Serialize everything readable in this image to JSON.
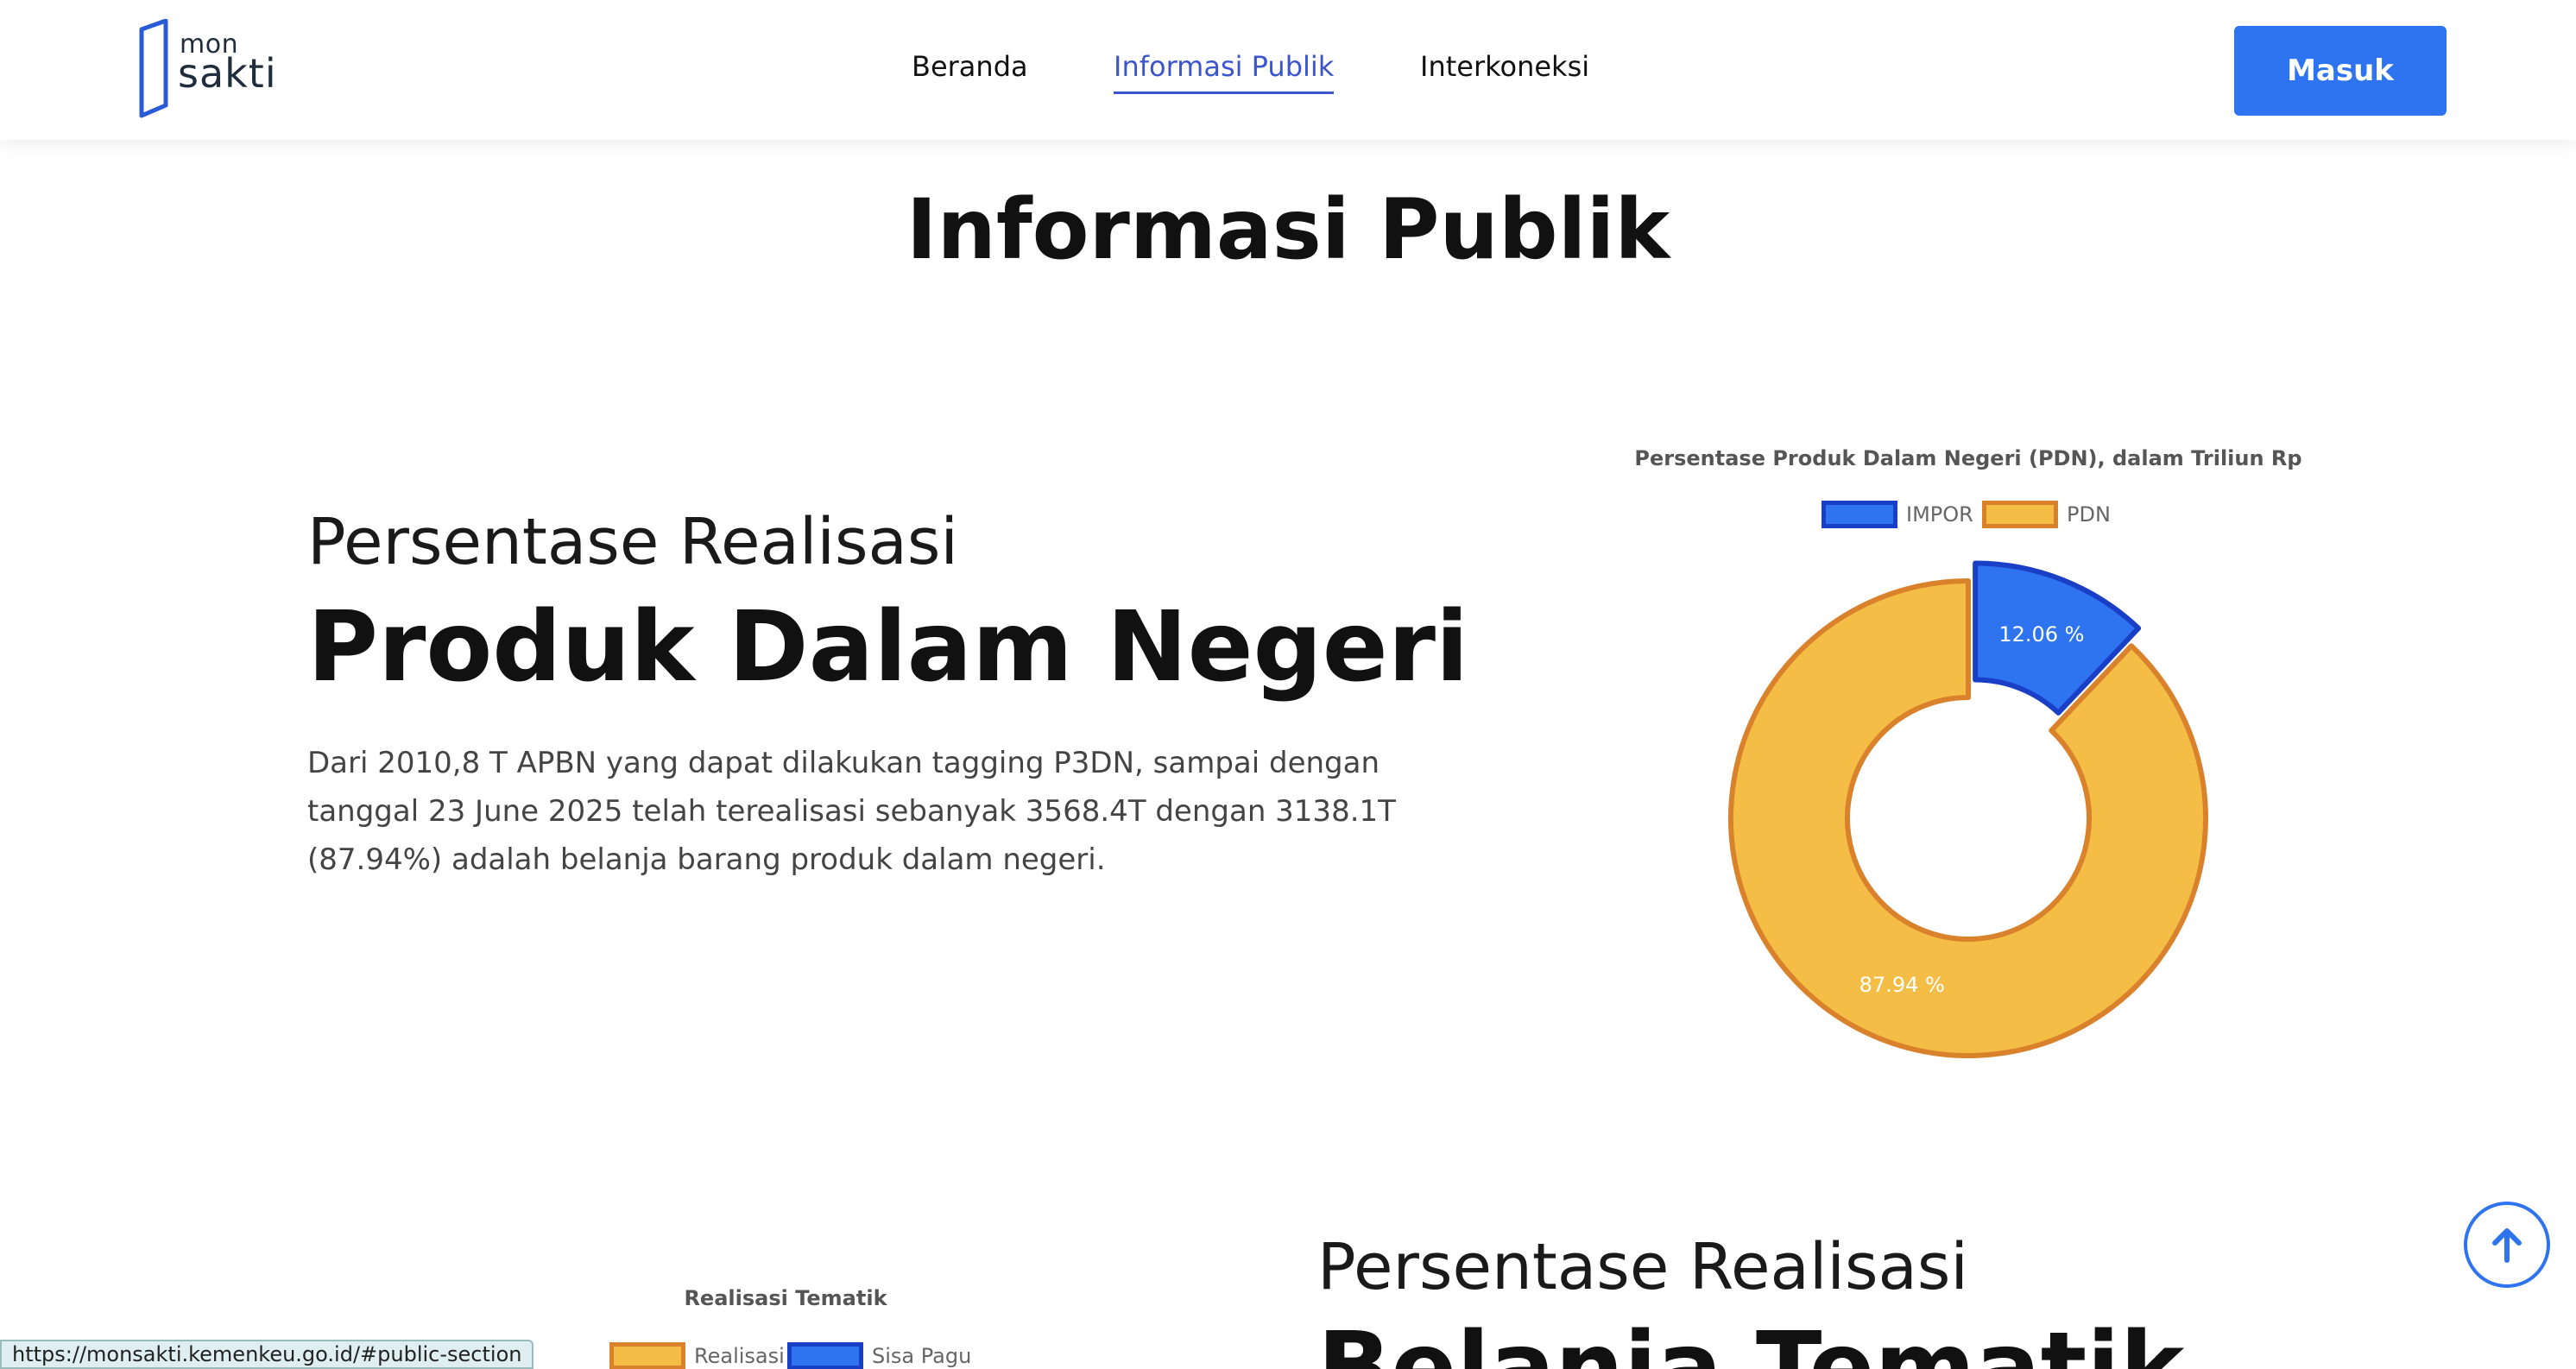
{
  "header": {
    "logo_top": "mon",
    "logo_bottom": "sakti",
    "nav": [
      {
        "label": "Beranda"
      },
      {
        "label": "Informasi Publik"
      },
      {
        "label": "Interkoneksi"
      }
    ],
    "login_label": "Masuk"
  },
  "page": {
    "title": "Informasi Publik"
  },
  "section_pdn": {
    "subtitle": "Persentase Realisasi",
    "heading": "Produk Dalam Negeri",
    "description": "Dari 2010,8 T APBN yang dapat dilakukan tagging P3DN, sampai dengan tanggal 23 June 2025 telah terealisasi sebanyak 3568.4T dengan 3138.1T (87.94%) adalah belanja barang produk dalam negeri."
  },
  "chart_data": [
    {
      "type": "pie",
      "title": "Persentase Produk Dalam Negeri (PDN), dalam Triliun Rp",
      "legend_position": "top",
      "series": [
        {
          "name": "IMPOR",
          "value": 12.06,
          "label": "12.06 %",
          "color": "#2e74f0",
          "border": "#1a3fc7"
        },
        {
          "name": "PDN",
          "value": 87.94,
          "label": "87.94 %",
          "color": "#f4bd45",
          "border": "#d9822b"
        }
      ]
    },
    {
      "type": "pie",
      "title": "Realisasi Tematik",
      "legend_position": "top",
      "series": [
        {
          "name": "Realisasi",
          "color": "#f4bd45",
          "border": "#d9822b"
        },
        {
          "name": "Sisa Pagu",
          "color": "#2e74f0",
          "border": "#1a3fc7"
        }
      ]
    }
  ],
  "section_tematik": {
    "subtitle": "Persentase Realisasi",
    "heading": "Belanja Tematik"
  },
  "status_url": "https://monsakti.kemenkeu.go.id/#public-section"
}
